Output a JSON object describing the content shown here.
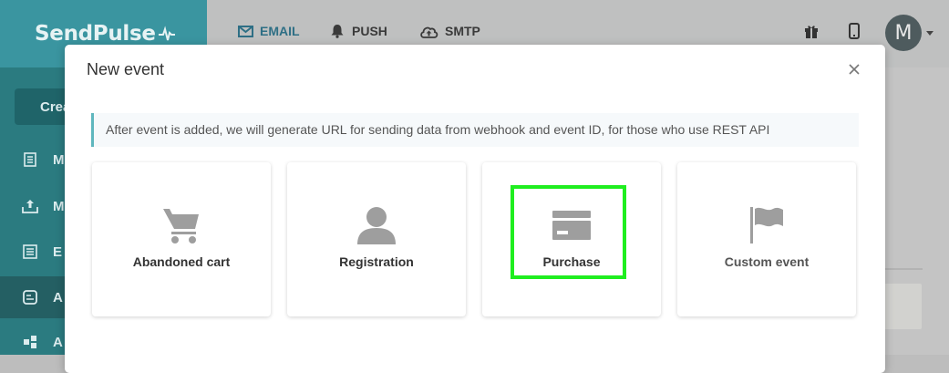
{
  "brand": {
    "name": "SendPulse"
  },
  "sidebar": {
    "create_label": "Crea",
    "items": [
      {
        "label": "M",
        "icon": "list-icon"
      },
      {
        "label": "M",
        "icon": "upload-icon"
      },
      {
        "label": "E",
        "icon": "newspaper-icon"
      },
      {
        "label": "A",
        "icon": "automation-icon",
        "active": true
      },
      {
        "label": "A",
        "icon": "puzzle-icon"
      }
    ]
  },
  "topnav": {
    "email": "EMAIL",
    "push": "PUSH",
    "smtp": "SMTP",
    "avatar_letter": "M"
  },
  "modal": {
    "title": "New event",
    "info": "After event is added, we will generate URL for sending data from webhook and event ID, for those who use REST API",
    "cards": [
      {
        "label": "Abandoned cart",
        "icon": "cart-icon"
      },
      {
        "label": "Registration",
        "icon": "user-icon"
      },
      {
        "label": "Purchase",
        "icon": "credit-card-icon",
        "highlighted": true
      },
      {
        "label": "Custom event",
        "icon": "flag-icon"
      }
    ]
  },
  "colors": {
    "sidebar": "#2b7b80",
    "sidebar_header": "#3a95a0",
    "highlight": "#1fee1f",
    "info_border": "#5fb7be",
    "icon_gray": "#9e9e9e"
  }
}
